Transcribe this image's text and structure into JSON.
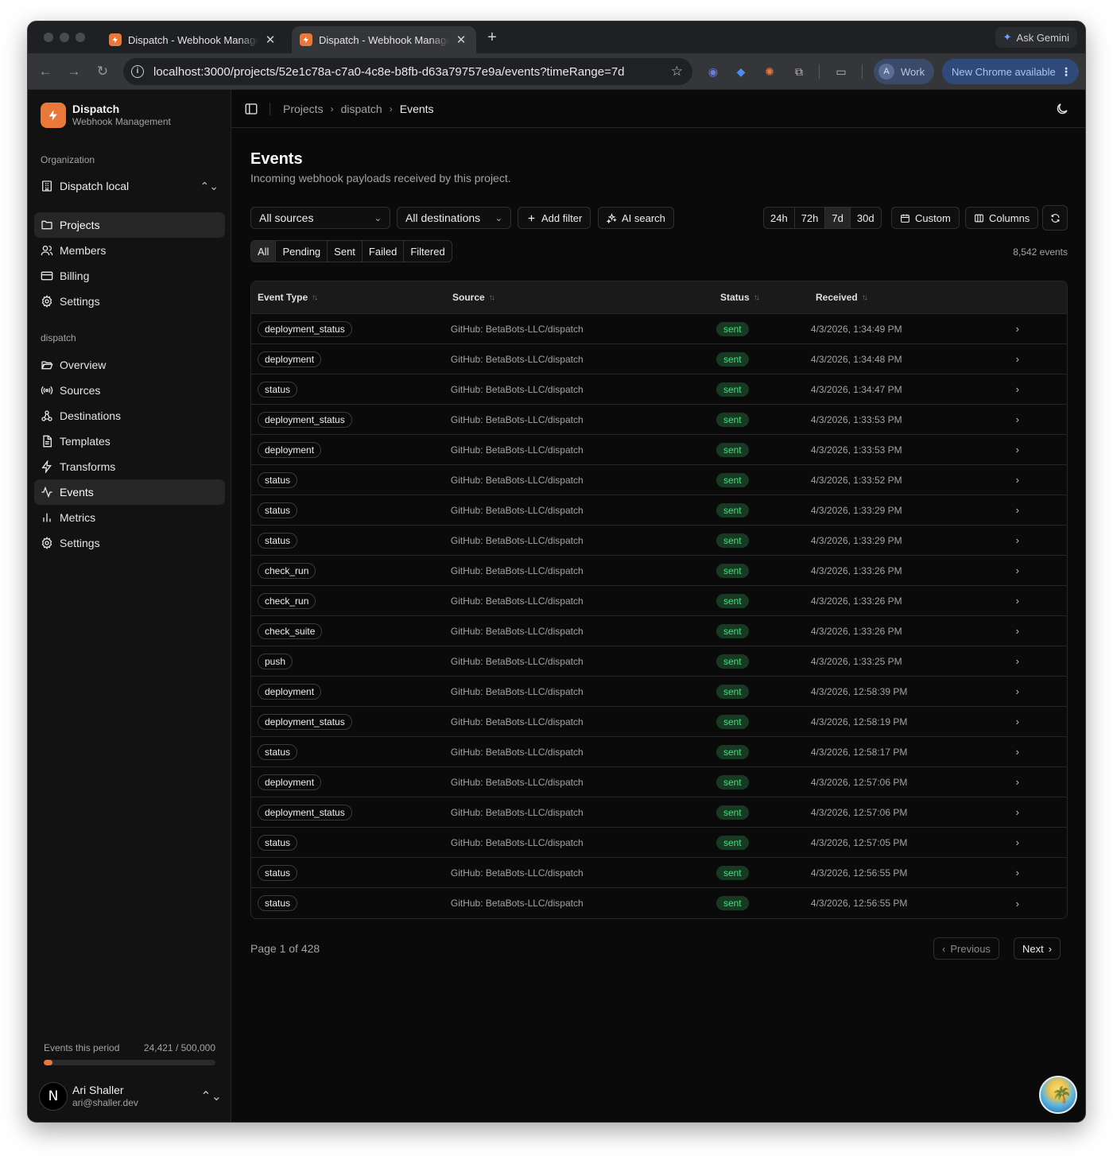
{
  "browser": {
    "tabs": [
      {
        "title": "Dispatch - Webhook Management",
        "active": false
      },
      {
        "title": "Dispatch - Webhook Management",
        "active": true
      }
    ],
    "ask_gemini": "Ask Gemini",
    "url": "localhost:3000/projects/52e1c78a-c7a0-4c8e-b8fb-d63a79757e9a/events?timeRange=7d",
    "profile_initial": "A",
    "profile_label": "Work",
    "update_label": "New Chrome available"
  },
  "brand": {
    "name": "Dispatch",
    "subtitle": "Webhook Management",
    "color": "#e8793a"
  },
  "sidebar": {
    "org_label": "Organization",
    "org_name": "Dispatch local",
    "org_items": [
      {
        "label": "Projects",
        "icon": "folder-icon",
        "active": true
      },
      {
        "label": "Members",
        "icon": "users-icon",
        "active": false
      },
      {
        "label": "Billing",
        "icon": "credit-card-icon",
        "active": false
      },
      {
        "label": "Settings",
        "icon": "gear-icon",
        "active": false
      }
    ],
    "project_label": "dispatch",
    "project_items": [
      {
        "label": "Overview",
        "icon": "folder-open-icon",
        "active": false
      },
      {
        "label": "Sources",
        "icon": "radio-icon",
        "active": false
      },
      {
        "label": "Destinations",
        "icon": "webhook-icon",
        "active": false
      },
      {
        "label": "Templates",
        "icon": "file-text-icon",
        "active": false
      },
      {
        "label": "Transforms",
        "icon": "bolt-icon",
        "active": false
      },
      {
        "label": "Events",
        "icon": "activity-icon",
        "active": true
      },
      {
        "label": "Metrics",
        "icon": "bar-chart-icon",
        "active": false
      },
      {
        "label": "Settings",
        "icon": "gear-icon",
        "active": false
      }
    ],
    "usage": {
      "label": "Events this period",
      "value": "24,421 / 500,000",
      "fraction": 0.0488
    },
    "user": {
      "initial": "N",
      "name": "Ari Shaller",
      "email": "ari@shaller.dev"
    }
  },
  "breadcrumb": [
    "Projects",
    "dispatch",
    "Events"
  ],
  "page": {
    "title": "Events",
    "subtitle": "Incoming webhook payloads received by this project."
  },
  "filters": {
    "sources": "All sources",
    "destinations": "All destinations",
    "add_filter": "Add filter",
    "ai_search": "AI search",
    "time_ranges": [
      "24h",
      "72h",
      "7d",
      "30d"
    ],
    "time_selected": "7d",
    "custom": "Custom",
    "columns": "Columns",
    "status_tabs": [
      "All",
      "Pending",
      "Sent",
      "Failed",
      "Filtered"
    ],
    "status_selected": "All",
    "count": "8,542 events"
  },
  "table": {
    "headers": [
      "Event Type",
      "Source",
      "Status",
      "Received"
    ],
    "rows": [
      {
        "type": "deployment_status",
        "source": "GitHub: BetaBots-LLC/dispatch",
        "status": "sent",
        "received": "4/3/2026, 1:34:49 PM"
      },
      {
        "type": "deployment",
        "source": "GitHub: BetaBots-LLC/dispatch",
        "status": "sent",
        "received": "4/3/2026, 1:34:48 PM"
      },
      {
        "type": "status",
        "source": "GitHub: BetaBots-LLC/dispatch",
        "status": "sent",
        "received": "4/3/2026, 1:34:47 PM"
      },
      {
        "type": "deployment_status",
        "source": "GitHub: BetaBots-LLC/dispatch",
        "status": "sent",
        "received": "4/3/2026, 1:33:53 PM"
      },
      {
        "type": "deployment",
        "source": "GitHub: BetaBots-LLC/dispatch",
        "status": "sent",
        "received": "4/3/2026, 1:33:53 PM"
      },
      {
        "type": "status",
        "source": "GitHub: BetaBots-LLC/dispatch",
        "status": "sent",
        "received": "4/3/2026, 1:33:52 PM"
      },
      {
        "type": "status",
        "source": "GitHub: BetaBots-LLC/dispatch",
        "status": "sent",
        "received": "4/3/2026, 1:33:29 PM"
      },
      {
        "type": "status",
        "source": "GitHub: BetaBots-LLC/dispatch",
        "status": "sent",
        "received": "4/3/2026, 1:33:29 PM"
      },
      {
        "type": "check_run",
        "source": "GitHub: BetaBots-LLC/dispatch",
        "status": "sent",
        "received": "4/3/2026, 1:33:26 PM"
      },
      {
        "type": "check_run",
        "source": "GitHub: BetaBots-LLC/dispatch",
        "status": "sent",
        "received": "4/3/2026, 1:33:26 PM"
      },
      {
        "type": "check_suite",
        "source": "GitHub: BetaBots-LLC/dispatch",
        "status": "sent",
        "received": "4/3/2026, 1:33:26 PM"
      },
      {
        "type": "push",
        "source": "GitHub: BetaBots-LLC/dispatch",
        "status": "sent",
        "received": "4/3/2026, 1:33:25 PM"
      },
      {
        "type": "deployment",
        "source": "GitHub: BetaBots-LLC/dispatch",
        "status": "sent",
        "received": "4/3/2026, 12:58:39 PM"
      },
      {
        "type": "deployment_status",
        "source": "GitHub: BetaBots-LLC/dispatch",
        "status": "sent",
        "received": "4/3/2026, 12:58:19 PM"
      },
      {
        "type": "status",
        "source": "GitHub: BetaBots-LLC/dispatch",
        "status": "sent",
        "received": "4/3/2026, 12:58:17 PM"
      },
      {
        "type": "deployment",
        "source": "GitHub: BetaBots-LLC/dispatch",
        "status": "sent",
        "received": "4/3/2026, 12:57:06 PM"
      },
      {
        "type": "deployment_status",
        "source": "GitHub: BetaBots-LLC/dispatch",
        "status": "sent",
        "received": "4/3/2026, 12:57:06 PM"
      },
      {
        "type": "status",
        "source": "GitHub: BetaBots-LLC/dispatch",
        "status": "sent",
        "received": "4/3/2026, 12:57:05 PM"
      },
      {
        "type": "status",
        "source": "GitHub: BetaBots-LLC/dispatch",
        "status": "sent",
        "received": "4/3/2026, 12:56:55 PM"
      },
      {
        "type": "status",
        "source": "GitHub: BetaBots-LLC/dispatch",
        "status": "sent",
        "received": "4/3/2026, 12:56:55 PM"
      }
    ]
  },
  "pagination": {
    "info": "Page 1 of 428",
    "previous": "Previous",
    "next": "Next"
  },
  "colors": {
    "accent": "#e8793a",
    "status_sent": "#4ade80",
    "background": "#0a0a0a"
  }
}
